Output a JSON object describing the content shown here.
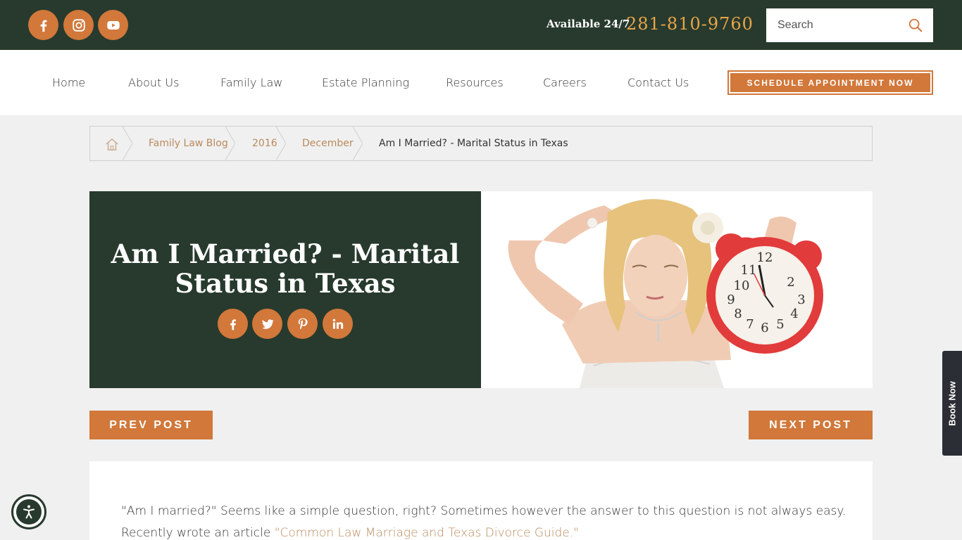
{
  "topbar": {
    "social_icons": [
      "facebook-icon",
      "instagram-icon",
      "youtube-icon"
    ],
    "available_label": "Available 24/7",
    "phone": "281-810-9760",
    "search_placeholder": "Search"
  },
  "nav": {
    "items": [
      "Home",
      "About Us",
      "Family Law",
      "Estate Planning",
      "Resources",
      "Careers",
      "Contact Us"
    ],
    "cta_label": "SCHEDULE APPOINTMENT NOW"
  },
  "breadcrumb": {
    "items": [
      "Family Law Blog",
      "2016",
      "December"
    ],
    "current": "Am I Married? - Marital Status in Texas"
  },
  "hero": {
    "title_line1": "Am I Married? - Marital",
    "title_line2": "Status in Texas",
    "share_icons": [
      "facebook-icon",
      "twitter-icon",
      "pinterest-icon",
      "linkedin-icon"
    ]
  },
  "post_nav": {
    "prev_label": "PREV POST",
    "next_label": "NEXT POST"
  },
  "content": {
    "intro": "\"Am I married?\" Seems like a simple question, right? Sometimes however the answer to this question is not always easy. Recently wrote an article ",
    "link_text": "\"Common Law Marriage and Texas Divorce Guide.\""
  },
  "book_now_label": "Book Now",
  "colors": {
    "dark_green": "#273a2d",
    "accent_orange": "#d1783a",
    "phone_gold": "#e8a548",
    "link_tan": "#b98a5c",
    "page_bg": "#f0f0f0"
  }
}
